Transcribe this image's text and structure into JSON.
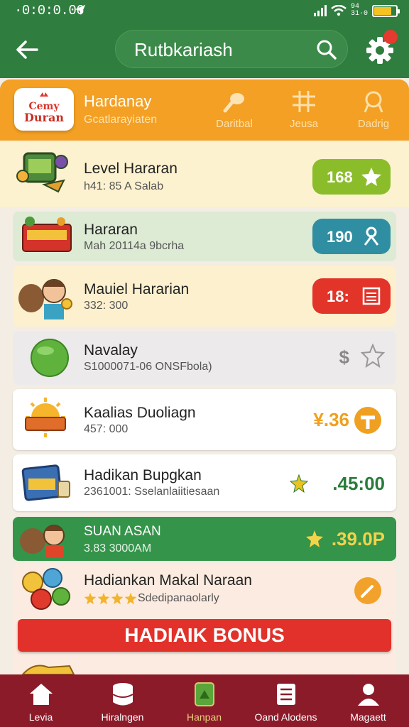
{
  "status_bar": {
    "time": "·0:0:0.06",
    "percent": "94 31·0"
  },
  "header": {
    "search_text": "Rutbkariash",
    "settings_badge": ""
  },
  "category_bar": {
    "brand_logo_text": "Cemy Duran",
    "brand_title": "Hardanay",
    "brand_subtitle": "Gcatlarayiaten",
    "tabs": [
      {
        "label": "Daritbal"
      },
      {
        "label": "Jeusa"
      },
      {
        "label": "Dadrig"
      }
    ]
  },
  "list": [
    {
      "title": "Level Hararan",
      "subtitle": "h41: 85 A Salab",
      "badge_value": "168",
      "badge_icon": "star-icon",
      "badge_color": "#8bbd2a",
      "bg": "#fcf2d0"
    },
    {
      "title": "Hararan",
      "subtitle": "Mah 20114a 9bcrha",
      "badge_value": "190",
      "badge_icon": "person-icon",
      "badge_color": "#2f8ea1",
      "bg": "#ddebd4"
    },
    {
      "title": "Mauiel Hararian",
      "subtitle": "332: 300",
      "badge_value": "18:",
      "badge_icon": "receipt-icon",
      "badge_color": "#e3342a",
      "bg": "#fcf0cf"
    },
    {
      "title": "Navalay",
      "subtitle": "S1000071-06 ONSFbola)",
      "price_symbol": "$",
      "bg": "#eceaea"
    },
    {
      "title": "Kaalias Duoliagn",
      "subtitle": "457: 000",
      "price": "¥.36",
      "price_color": "#f0a020",
      "bg": "#ffffff"
    },
    {
      "title": "Hadikan Bupgkan",
      "subtitle": "2361001: Sselanlaiitiesaan",
      "price": ".45:00",
      "price_color": "#2a7b3a",
      "bg": "#ffffff"
    },
    {
      "title": "SUAN ASAN",
      "subtitle": "3.83 3000AM",
      "price": ".39.0P",
      "price_color": "#f3d34a",
      "bg": "#34944a"
    },
    {
      "title": "Hadiankan Makal Naraan",
      "subtitle": "Sdedipanaolarly",
      "bg": "#fcebe0"
    }
  ],
  "bonus_button": "HADIAIK BONUS",
  "bottom_nav": [
    {
      "label": "Levia",
      "icon": "home-icon"
    },
    {
      "label": "Hiralngen",
      "icon": "database-icon"
    },
    {
      "label": "Hanpan",
      "icon": "tablet-icon",
      "active": true
    },
    {
      "label": "Oand Alodens",
      "icon": "list-icon"
    },
    {
      "label": "Magaett",
      "icon": "profile-icon"
    }
  ],
  "colors": {
    "header_green": "#2f7d3f",
    "category_orange": "#f3a024",
    "nav_maroon": "#8c1b2a",
    "bonus_red": "#e2312a"
  }
}
